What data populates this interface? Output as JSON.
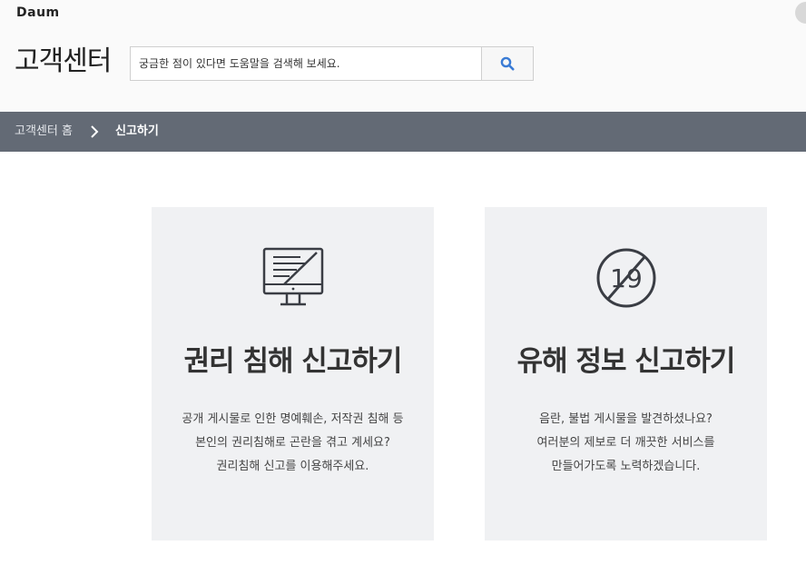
{
  "header": {
    "logo": "Daum",
    "title": "고객센터",
    "search": {
      "placeholder": "궁금한 점이 있다면 도움말을 검색해 보세요.",
      "button_icon": "search-icon"
    }
  },
  "breadcrumb": {
    "home": "고객센터 홈",
    "separator_icon": "chevron-right-icon",
    "current": "신고하기"
  },
  "cards": [
    {
      "icon": "monitor-report-icon",
      "title": "권리 침해 신고하기",
      "description": [
        "공개 게시물로 인한 명예훼손, 저작권 침해 등",
        "본인의 권리침해로 곤란을 겪고 계세요?",
        "권리침해 신고를 이용해주세요."
      ]
    },
    {
      "icon": "age-19-restricted-icon",
      "icon_text": "19",
      "title": "유해 정보 신고하기",
      "description": [
        "음란, 불법 게시물을 발견하셨나요?",
        "여러분의 제보로 더 깨끗한 서비스를",
        "만들어가도록 노력하겠습니다."
      ]
    }
  ],
  "colors": {
    "header_bg": "#fafafa",
    "navbar_bg": "#636a75",
    "card_bg": "#f0f1f3",
    "search_icon": "#3a7bd5",
    "icon_stroke": "#3a3d44"
  }
}
